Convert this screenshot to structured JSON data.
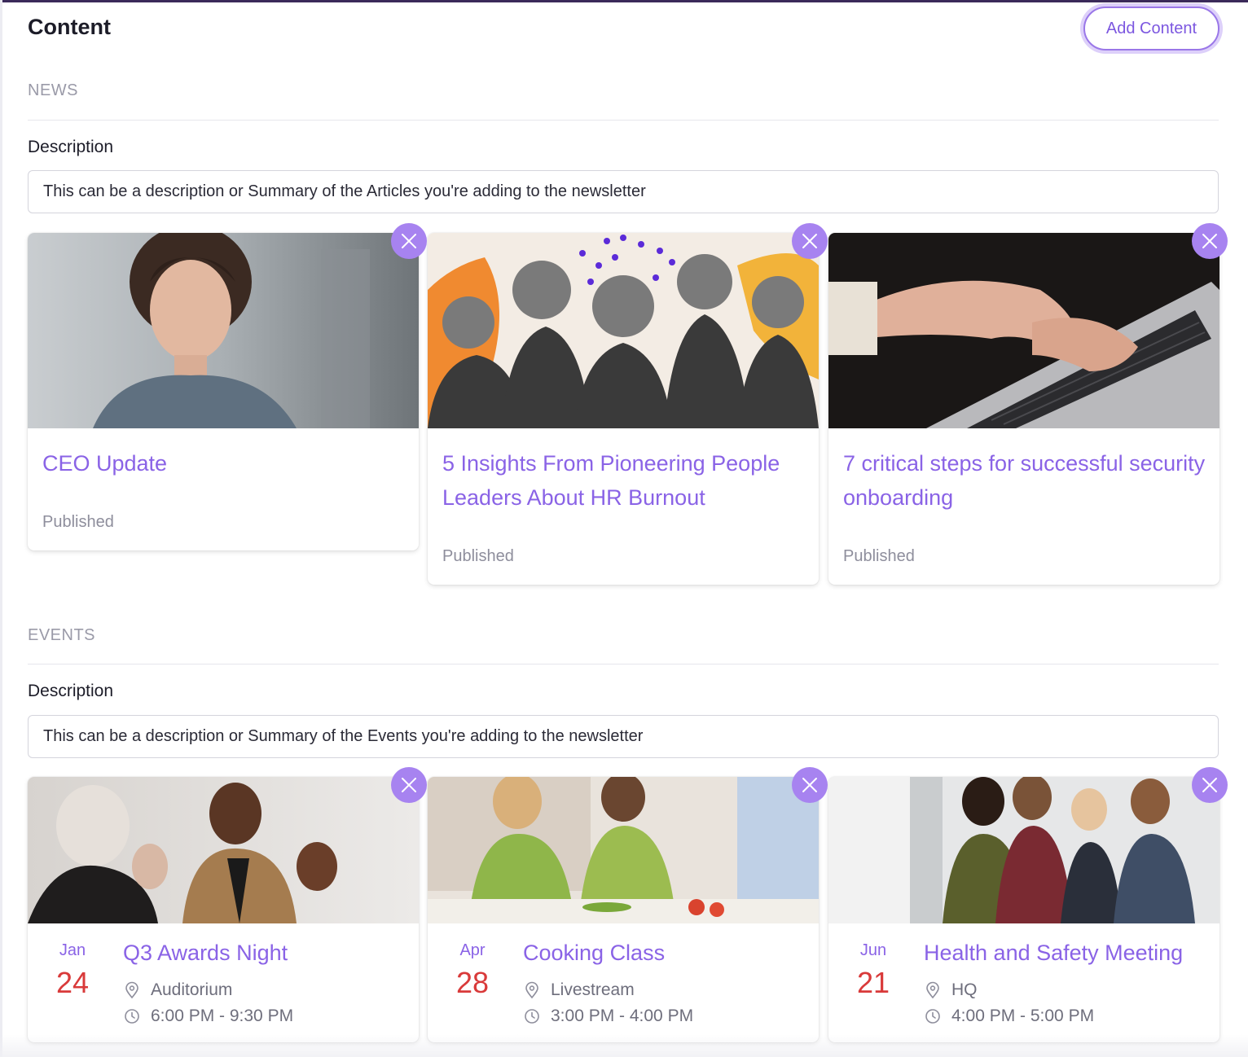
{
  "header": {
    "title": "Content",
    "add_button": "Add Content"
  },
  "news": {
    "section_label": "NEWS",
    "description_label": "Description",
    "description_value": "This can be a description or Summary of the Articles you're adding to the newsletter",
    "articles": [
      {
        "title": "CEO Update",
        "status": "Published"
      },
      {
        "title": "5 Insights From Pioneering People Leaders About HR Burnout",
        "status": "Published"
      },
      {
        "title": "7 critical steps for successful security onboarding",
        "status": "Published"
      }
    ]
  },
  "events": {
    "section_label": "EVENTS",
    "description_label": "Description",
    "description_value": "This can be a description or Summary of the Events you're adding to the newsletter",
    "items": [
      {
        "month": "Jan",
        "day": "24",
        "title": "Q3 Awards Night",
        "location": "Auditorium",
        "time": "6:00 PM - 9:30 PM"
      },
      {
        "month": "Apr",
        "day": "28",
        "title": "Cooking Class",
        "location": "Livestream",
        "time": "3:00 PM - 4:00 PM"
      },
      {
        "month": "Jun",
        "day": "21",
        "title": "Health and Safety Meeting",
        "location": "HQ",
        "time": "4:00 PM - 5:00 PM"
      }
    ]
  },
  "icons": {
    "remove": "close-icon",
    "location": "map-pin-icon",
    "time": "clock-icon"
  },
  "colors": {
    "accent": "#8a63e6",
    "remove_button": "#a783f0",
    "date_day": "#d93a3a"
  }
}
